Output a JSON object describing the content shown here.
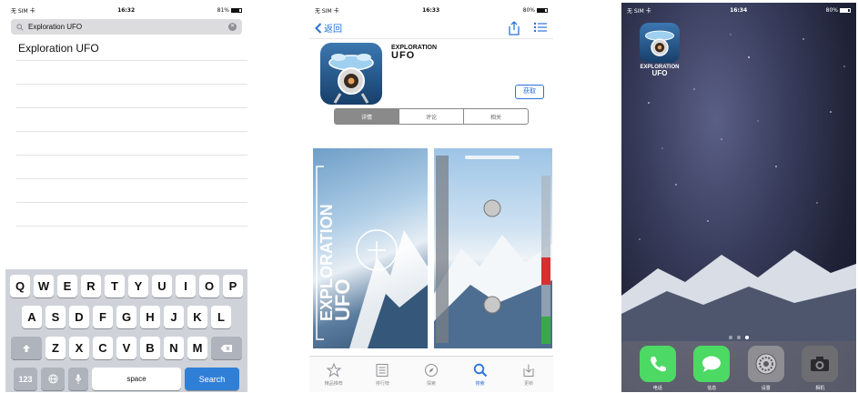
{
  "phone1": {
    "status": {
      "carrier": "无 SIM 卡",
      "time": "16:32",
      "battery": "81%"
    },
    "search": {
      "value": "Exploration UFO"
    },
    "results": [
      "Exploration UFO",
      "",
      "",
      "",
      "",
      "",
      "",
      ""
    ],
    "keyboard": {
      "row1": [
        "Q",
        "W",
        "E",
        "R",
        "T",
        "Y",
        "U",
        "I",
        "O",
        "P"
      ],
      "row2": [
        "A",
        "S",
        "D",
        "F",
        "G",
        "H",
        "J",
        "K",
        "L"
      ],
      "row3": [
        "Z",
        "X",
        "C",
        "V",
        "B",
        "N",
        "M"
      ],
      "numbers_key": "123",
      "space_key": "space",
      "search_key": "Search"
    }
  },
  "phone2": {
    "status": {
      "carrier": "无 SIM 卡",
      "time": "16:33",
      "battery": "80%"
    },
    "nav": {
      "back": "返回"
    },
    "app": {
      "name_line1": "EXPLORATION",
      "name_line2": "UFO",
      "get_button": "获取"
    },
    "segments": [
      "详情",
      "评论",
      "相关"
    ],
    "screenshot1": {
      "line1": "EXPLORATION",
      "line2": "UFO"
    },
    "tabs": [
      {
        "label": "精品推荐",
        "icon": "star-icon"
      },
      {
        "label": "排行榜",
        "icon": "list-icon"
      },
      {
        "label": "探索",
        "icon": "compass-icon"
      },
      {
        "label": "搜索",
        "icon": "search-icon"
      },
      {
        "label": "更新",
        "icon": "download-icon"
      }
    ]
  },
  "phone3": {
    "status": {
      "carrier": "无 SIM 卡",
      "time": "16:34",
      "battery": "80%"
    },
    "home_app": {
      "label_line1": "EXPLORATION",
      "label_line2": "UFO"
    },
    "dock": [
      {
        "label": "电话",
        "icon": "phone-icon",
        "color": "#4cd964"
      },
      {
        "label": "信息",
        "icon": "messages-icon",
        "color": "#4cd964"
      },
      {
        "label": "设置",
        "icon": "settings-icon",
        "color": "#8e8e93"
      },
      {
        "label": "相机",
        "icon": "camera-icon",
        "color": "#6d6d72"
      }
    ]
  }
}
